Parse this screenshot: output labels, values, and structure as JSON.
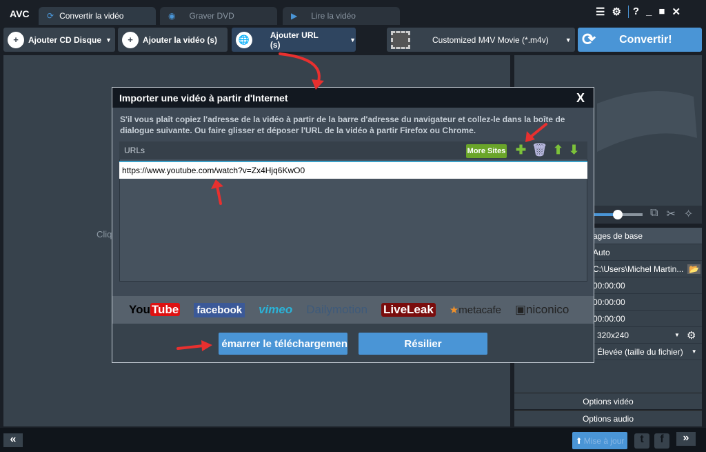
{
  "app": {
    "logo": "AVC"
  },
  "tabs": [
    {
      "label": "Convertir la vidéo"
    },
    {
      "label": "Graver DVD"
    },
    {
      "label": "Lire la vidéo"
    }
  ],
  "window_controls": {
    "help": "?"
  },
  "toolbar": {
    "add_cd": "Ajouter CD Disque",
    "add_video": "Ajouter la vidéo (s)",
    "add_url": "Ajouter URL (s)",
    "profile": "Customized M4V Movie (*.m4v)",
    "convert": "Convertir!"
  },
  "main": {
    "hint": "Cliq"
  },
  "right_panel": {
    "section": "ages de base",
    "rows": [
      "Auto",
      "C:\\Users\\Michel Martin...",
      "00:00:00",
      "00:00:00",
      "00:00:00",
      "320x240",
      "Élevée (taille du fichier)"
    ],
    "options_video": "Options vidéo",
    "options_audio": "Options audio",
    "slider_value": 0.45
  },
  "dialog": {
    "title": "Importer une vidéo à partir d'Internet",
    "close": "X",
    "instructions": "S'il vous plaît copiez l'adresse de la vidéo à partir de la barre d'adresse du navigateur et collez-le dans la boîte de dialogue suivante. Ou faire glisser et déposer l'URL de la vidéo à partir Firefox ou Chrome.",
    "urls_label": "URLs",
    "more_sites": "More Sites",
    "url_value": "https://www.youtube.com/watch?v=Zx4Hjq6KwO0",
    "sites": [
      "YouTube",
      "facebook",
      "vimeo",
      "Dailymotion",
      "LiveLeak",
      "metacafe",
      "niconico"
    ],
    "start": "émarrer le téléchargemen",
    "cancel": "Résilier"
  },
  "bottom": {
    "update": "Mise à jour",
    "collapse": "«",
    "expand": "»"
  }
}
